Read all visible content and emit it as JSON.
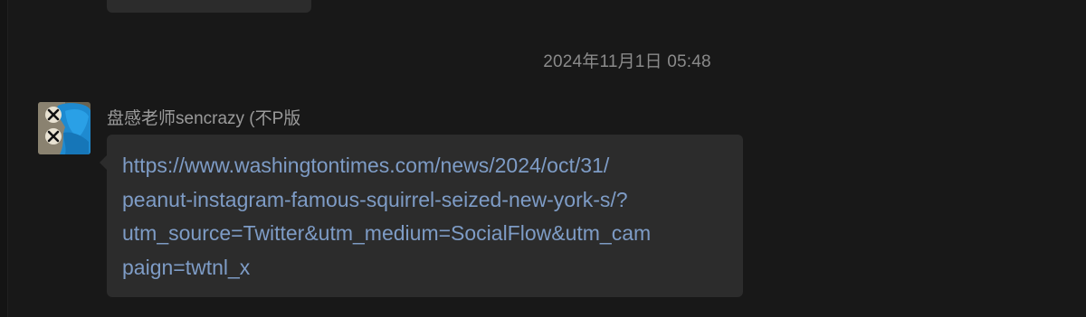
{
  "timestamp": "2024年11月1日 05:48",
  "message": {
    "sender": "盘感老师sencrazy (不P版",
    "avatar_icon": "cookie-monster-avatar",
    "link_lines": [
      "https://www.washingtontimes.com/news/2024/oct/31/",
      "peanut-instagram-famous-squirrel-seized-new-york-s/?",
      "utm_source=Twitter&utm_medium=SocialFlow&utm_cam",
      "paign=twtnl_x"
    ]
  },
  "colors": {
    "background": "#181818",
    "bubble": "#2c2c2c",
    "link": "#7e9cc6",
    "muted_text": "#8a8a8a"
  }
}
